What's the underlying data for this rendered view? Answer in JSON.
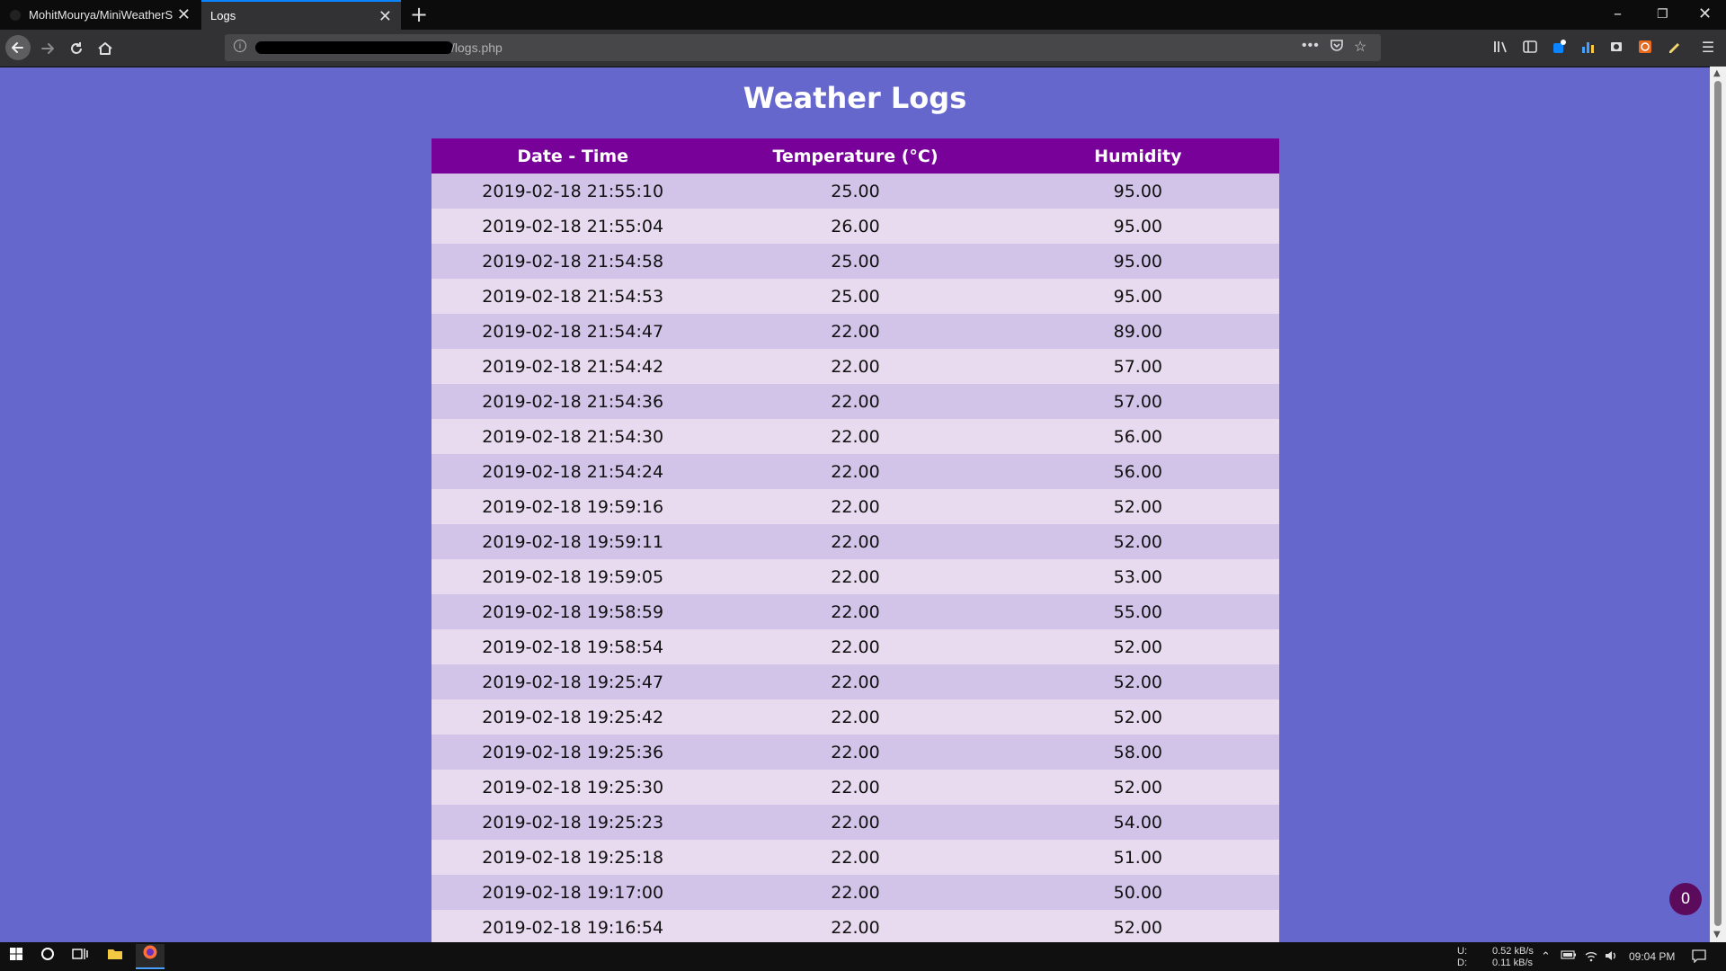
{
  "browser": {
    "tabs": [
      {
        "title": "MohitMourya/MiniWeatherSta",
        "active": false
      },
      {
        "title": "Logs",
        "active": true
      }
    ],
    "url_path": "/logs.php",
    "new_tab_label": "+"
  },
  "page": {
    "title": "Weather Logs",
    "columns": [
      "Date - Time",
      "Temperature (°C)",
      "Humidity"
    ],
    "rows": [
      {
        "datetime": "2019-02-18 21:55:10",
        "temperature": "25.00",
        "humidity": "95.00"
      },
      {
        "datetime": "2019-02-18 21:55:04",
        "temperature": "26.00",
        "humidity": "95.00"
      },
      {
        "datetime": "2019-02-18 21:54:58",
        "temperature": "25.00",
        "humidity": "95.00"
      },
      {
        "datetime": "2019-02-18 21:54:53",
        "temperature": "25.00",
        "humidity": "95.00"
      },
      {
        "datetime": "2019-02-18 21:54:47",
        "temperature": "22.00",
        "humidity": "89.00"
      },
      {
        "datetime": "2019-02-18 21:54:42",
        "temperature": "22.00",
        "humidity": "57.00"
      },
      {
        "datetime": "2019-02-18 21:54:36",
        "temperature": "22.00",
        "humidity": "57.00"
      },
      {
        "datetime": "2019-02-18 21:54:30",
        "temperature": "22.00",
        "humidity": "56.00"
      },
      {
        "datetime": "2019-02-18 21:54:24",
        "temperature": "22.00",
        "humidity": "56.00"
      },
      {
        "datetime": "2019-02-18 19:59:16",
        "temperature": "22.00",
        "humidity": "52.00"
      },
      {
        "datetime": "2019-02-18 19:59:11",
        "temperature": "22.00",
        "humidity": "52.00"
      },
      {
        "datetime": "2019-02-18 19:59:05",
        "temperature": "22.00",
        "humidity": "53.00"
      },
      {
        "datetime": "2019-02-18 19:58:59",
        "temperature": "22.00",
        "humidity": "55.00"
      },
      {
        "datetime": "2019-02-18 19:58:54",
        "temperature": "22.00",
        "humidity": "52.00"
      },
      {
        "datetime": "2019-02-18 19:25:47",
        "temperature": "22.00",
        "humidity": "52.00"
      },
      {
        "datetime": "2019-02-18 19:25:42",
        "temperature": "22.00",
        "humidity": "52.00"
      },
      {
        "datetime": "2019-02-18 19:25:36",
        "temperature": "22.00",
        "humidity": "58.00"
      },
      {
        "datetime": "2019-02-18 19:25:30",
        "temperature": "22.00",
        "humidity": "52.00"
      },
      {
        "datetime": "2019-02-18 19:25:23",
        "temperature": "22.00",
        "humidity": "54.00"
      },
      {
        "datetime": "2019-02-18 19:25:18",
        "temperature": "22.00",
        "humidity": "51.00"
      },
      {
        "datetime": "2019-02-18 19:17:00",
        "temperature": "22.00",
        "humidity": "50.00"
      },
      {
        "datetime": "2019-02-18 19:16:54",
        "temperature": "22.00",
        "humidity": "52.00"
      }
    ],
    "badge_count": "0"
  },
  "taskbar": {
    "net_up_label": "U:",
    "net_down_label": "D:",
    "net_up": "0.52 kB/s",
    "net_down": "0.11 kB/s",
    "clock": "09:04 PM"
  },
  "colors": {
    "page_background": "#6667cc",
    "header_background": "#770199",
    "row_odd": "#d2c4e9",
    "row_even": "#e8dbef",
    "badge": "#5c0a5c"
  },
  "icons": {
    "back": "arrow-left-icon",
    "forward": "arrow-right-icon",
    "reload": "reload-icon",
    "home": "home-icon",
    "site_info": "info-icon",
    "page_actions": "more-dots-icon",
    "pocket": "pocket-icon",
    "bookmark": "star-icon",
    "library": "library-icon",
    "sidebar": "sidebar-icon",
    "menu": "hamburger-menu-icon",
    "windows_start": "windows-logo-icon",
    "search": "cortana-circle-icon",
    "task_view": "task-view-icon",
    "file_explorer": "folder-icon",
    "firefox": "firefox-icon"
  }
}
